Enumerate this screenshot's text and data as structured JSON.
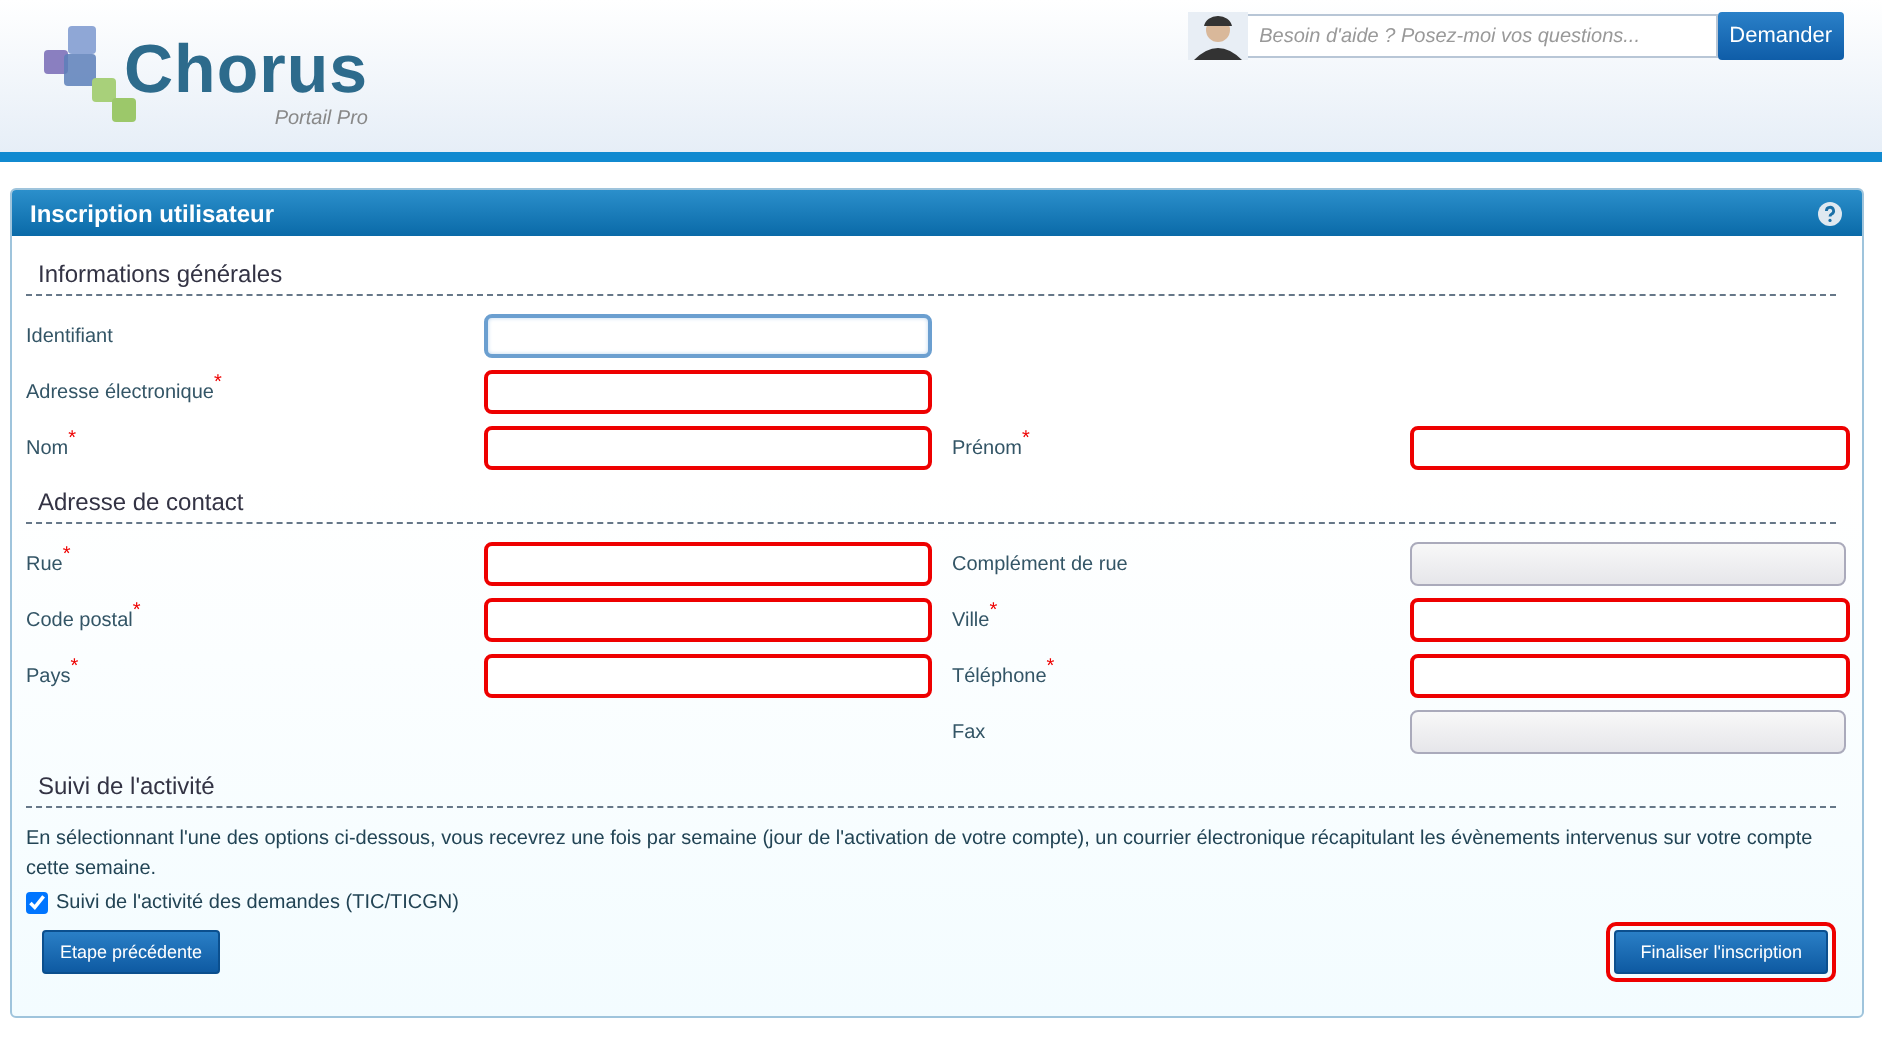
{
  "header": {
    "logo": {
      "name": "Chorus",
      "subtitle": "Portail Pro"
    },
    "help_search": {
      "placeholder": "Besoin d'aide ? Posez-moi vos questions...",
      "button": "Demander"
    }
  },
  "panel": {
    "title": "Inscription utilisateur",
    "sections": [
      {
        "title": "Informations générales",
        "rows": [
          [
            {
              "label": "Identifiant",
              "invalid": false,
              "focused": true
            }
          ],
          [
            {
              "label": "Adresse électronique",
              "required_mark": "*",
              "invalid": true,
              "focused": false
            }
          ],
          [
            {
              "label": "Nom",
              "required_mark": "*",
              "invalid": true,
              "focused": false
            },
            {
              "label": "Prénom",
              "required_mark": "*",
              "invalid": true,
              "focused": false
            }
          ]
        ]
      },
      {
        "title": "Adresse de contact",
        "rows": [
          [
            {
              "label": "Rue",
              "required_mark": "*",
              "invalid": true,
              "focused": false
            },
            {
              "label": "Complément de rue",
              "invalid": false,
              "focused": false
            }
          ],
          [
            {
              "label": "Code postal",
              "required_mark": "*",
              "invalid": true,
              "focused": false
            },
            {
              "label": "Ville",
              "required_mark": "*",
              "invalid": true,
              "focused": false
            }
          ],
          [
            {
              "label": "Pays",
              "required_mark": "*",
              "invalid": true,
              "focused": false
            },
            {
              "label": "Téléphone",
              "required_mark": "*",
              "invalid": true,
              "focused": false
            }
          ],
          [
            null,
            {
              "label": "Fax",
              "invalid": false,
              "focused": false
            }
          ]
        ]
      },
      {
        "title": "Suivi de l'activité",
        "text": "En sélectionnant l'une des options ci-dessous, vous recevrez une fois par semaine (jour de l'activation de votre compte), un courrier électronique récapitulant les évènements intervenus sur votre compte cette semaine.",
        "options": [
          {
            "label": "Suivi de l'activité des demandes (TIC/TICGN)",
            "checked": true
          }
        ]
      }
    ],
    "buttons": [
      {
        "label": "Etape précédente",
        "highlighted": false
      },
      {
        "label": "Finaliser l'inscription",
        "highlighted": true
      }
    ]
  }
}
